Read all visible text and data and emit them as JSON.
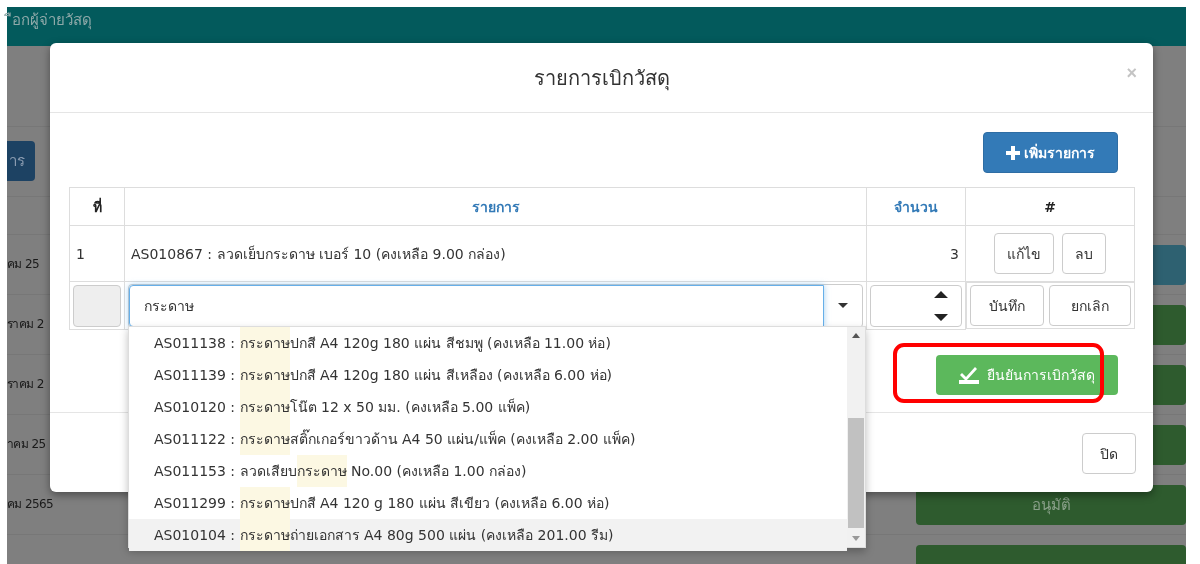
{
  "background_page": {
    "header_title": "ือกผู้จ่ายวัสดุ",
    "toolbar_button": "าร",
    "rows": [
      {
        "date": "คม 25",
        "button": {
          "kind": "info"
        }
      },
      {
        "date": "ราคม 2",
        "button": {
          "kind": "success"
        }
      },
      {
        "date": "ราคม 2",
        "button": {
          "kind": "success"
        }
      },
      {
        "date": "าคม 25",
        "button": {
          "kind": "success"
        }
      },
      {
        "date": "คม 2565",
        "button": {
          "kind": "success",
          "label": "อนุมัติ"
        }
      },
      {
        "button": {
          "kind": "success"
        }
      }
    ]
  },
  "modal": {
    "title": "รายการเบิกวัสดุ",
    "close": "×",
    "add_button": "เพิ่มรายการ",
    "table": {
      "columns": [
        {
          "label": "ที่",
          "kind": "plain"
        },
        {
          "label": "รายการ",
          "kind": "sortable"
        },
        {
          "label": "จำนวน",
          "kind": "sortable"
        },
        {
          "label": "#",
          "kind": "plain"
        }
      ],
      "rows": [
        {
          "no": "1",
          "item": "AS010867 : ลวดเย็บกระดาษ เบอร์ 10 (คงเหลือ 9.00 กล่อง)",
          "quantity": "3",
          "actions": [
            "แก้ไข",
            "ลบ"
          ]
        }
      ],
      "entry_row": {
        "item_value": "กระดาษ",
        "focused": true,
        "actions": [
          "บันทึก",
          "ยกเลิก"
        ]
      }
    },
    "confirm_button": "ยืนยันการเบิกวัสดุ",
    "close_button": "ปิด"
  },
  "dropdown": {
    "options": [
      {
        "prefix": "AS011138 : ",
        "match": "กระดาษ",
        "suffix": "ปกสี A4 120g 180 แผ่น สีชมพู (คงเหลือ 11.00 ห่อ)",
        "selected": false
      },
      {
        "prefix": "AS011139 : ",
        "match": "กระดาษ",
        "suffix": "ปกสี A4 120g 180 แผ่น สีเหลือง (คงเหลือ 6.00 ห่อ)",
        "selected": false
      },
      {
        "prefix": "AS010120 : ",
        "match": "กระดาษ",
        "suffix": "โน๊ต 12 x 50 มม. (คงเหลือ 5.00 แพ็ค)",
        "selected": false
      },
      {
        "prefix": "AS011122 : ",
        "match": "กระดาษ",
        "suffix": "สติ๊กเกอร์ขาวด้าน A4 50 แผ่น/แพ็ค (คงเหลือ 2.00 แพ็ค)",
        "selected": false
      },
      {
        "prefix": "AS011153 : ลวดเสียบ",
        "match": "กระดาษ",
        "suffix": " No.00 (คงเหลือ 1.00 กล่อง)",
        "selected": false
      },
      {
        "prefix": "AS011299 : ",
        "match": "กระดาษ",
        "suffix": "ปกสี A4 120 g 180 แผ่น สีเขียว (คงเหลือ 6.00 ห่อ)",
        "selected": false
      },
      {
        "prefix": "AS010104 : ",
        "match": "กระดาษ",
        "suffix": "ถ่ายเอกสาร A4 80g 500 แผ่น (คงเหลือ 201.00 รีม)",
        "selected": true
      }
    ]
  }
}
